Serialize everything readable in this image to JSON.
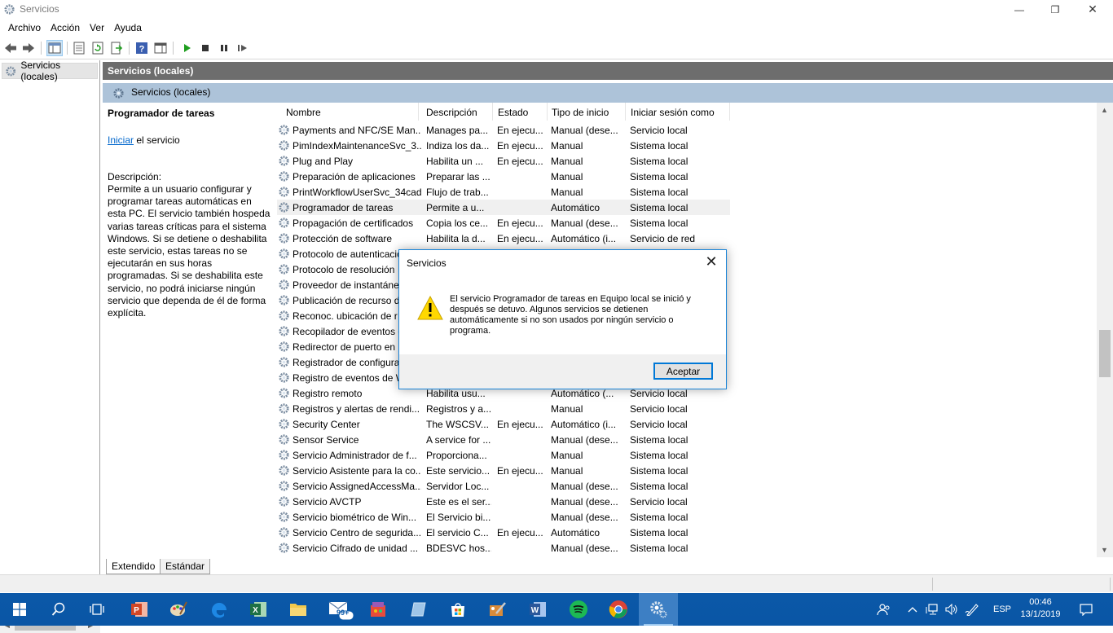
{
  "window": {
    "title": "Servicios",
    "controls": {
      "minimize": "—",
      "maximize": "❐",
      "close": "✕"
    }
  },
  "menu": [
    "Archivo",
    "Acción",
    "Ver",
    "Ayuda"
  ],
  "tree": {
    "root_label": "Servicios (locales)"
  },
  "header": {
    "title": "Servicios (locales)",
    "subtitle": "Servicios (locales)"
  },
  "details": {
    "service_title": "Programador de tareas",
    "action_link": "Iniciar",
    "action_suffix": " el servicio",
    "description_label": "Descripción:",
    "description_text": "Permite a un usuario configurar y programar tareas automáticas en esta PC. El servicio también hospeda varias tareas críticas para el sistema Windows. Si se detiene o deshabilita este servicio, estas tareas no se ejecutarán en sus horas programadas. Si se deshabilita este servicio, no podrá iniciarse ningún servicio que dependa de él de forma explícita."
  },
  "columns": [
    "Nombre",
    "Descripción",
    "Estado",
    "Tipo de inicio",
    "Iniciar sesión como"
  ],
  "rows": [
    {
      "name": "Payments and NFC/SE Man...",
      "desc": "Manages pa...",
      "state": "En ejecu...",
      "start": "Manual (dese...",
      "logon": "Servicio local"
    },
    {
      "name": "PimIndexMaintenanceSvc_3...",
      "desc": "Indiza los da...",
      "state": "En ejecu...",
      "start": "Manual",
      "logon": "Sistema local"
    },
    {
      "name": "Plug and Play",
      "desc": "Habilita un ...",
      "state": "En ejecu...",
      "start": "Manual",
      "logon": "Sistema local"
    },
    {
      "name": "Preparación de aplicaciones",
      "desc": "Preparar las ...",
      "state": "",
      "start": "Manual",
      "logon": "Sistema local"
    },
    {
      "name": "PrintWorkflowUserSvc_34cad",
      "desc": "Flujo de trab...",
      "state": "",
      "start": "Manual",
      "logon": "Sistema local"
    },
    {
      "name": "Programador de tareas",
      "desc": "Permite a u...",
      "state": "",
      "start": "Automático",
      "logon": "Sistema local",
      "selected": true
    },
    {
      "name": "Propagación de certificados",
      "desc": "Copia los ce...",
      "state": "En ejecu...",
      "start": "Manual (dese...",
      "logon": "Sistema local"
    },
    {
      "name": "Protección de software",
      "desc": "Habilita la d...",
      "state": "En ejecu...",
      "start": "Automático (i...",
      "logon": "Servicio de red"
    },
    {
      "name": "Protocolo de autenticación",
      "desc": "",
      "state": "",
      "start": "",
      "logon": ""
    },
    {
      "name": "Protocolo de resolución",
      "desc": "",
      "state": "",
      "start": "",
      "logon": ""
    },
    {
      "name": "Proveedor de instantáne",
      "desc": "",
      "state": "",
      "start": "",
      "logon": ""
    },
    {
      "name": "Publicación de recurso d",
      "desc": "",
      "state": "",
      "start": "",
      "logon": ""
    },
    {
      "name": "Reconoc. ubicación de r",
      "desc": "",
      "state": "",
      "start": "",
      "logon": ""
    },
    {
      "name": "Recopilador de eventos d",
      "desc": "",
      "state": "",
      "start": "",
      "logon": ""
    },
    {
      "name": "Redirector de puerto en",
      "desc": "",
      "state": "",
      "start": "",
      "logon": ""
    },
    {
      "name": "Registrador de configura",
      "desc": "",
      "state": "",
      "start": "",
      "logon": ""
    },
    {
      "name": "Registro de eventos de W",
      "desc": "",
      "state": "",
      "start": "",
      "logon": ""
    },
    {
      "name": "Registro remoto",
      "desc": "Habilita usu...",
      "state": "",
      "start": "Automático (...",
      "logon": "Servicio local"
    },
    {
      "name": "Registros y alertas de rendi...",
      "desc": "Registros y a...",
      "state": "",
      "start": "Manual",
      "logon": "Servicio local"
    },
    {
      "name": "Security Center",
      "desc": "The WSCSV...",
      "state": "En ejecu...",
      "start": "Automático (i...",
      "logon": "Servicio local"
    },
    {
      "name": "Sensor Service",
      "desc": "A service for ...",
      "state": "",
      "start": "Manual (dese...",
      "logon": "Sistema local"
    },
    {
      "name": "Servicio Administrador de f...",
      "desc": "Proporciona...",
      "state": "",
      "start": "Manual",
      "logon": "Sistema local"
    },
    {
      "name": "Servicio Asistente para la co...",
      "desc": "Este servicio...",
      "state": "En ejecu...",
      "start": "Manual",
      "logon": "Sistema local"
    },
    {
      "name": "Servicio AssignedAccessMa...",
      "desc": "Servidor Loc...",
      "state": "",
      "start": "Manual (dese...",
      "logon": "Sistema local"
    },
    {
      "name": "Servicio AVCTP",
      "desc": "Este es el ser...",
      "state": "",
      "start": "Manual (dese...",
      "logon": "Servicio local"
    },
    {
      "name": "Servicio biométrico de Win...",
      "desc": "El Servicio bi...",
      "state": "",
      "start": "Manual (dese...",
      "logon": "Sistema local"
    },
    {
      "name": "Servicio Centro de segurida...",
      "desc": "El servicio C...",
      "state": "En ejecu...",
      "start": "Automático",
      "logon": "Sistema local"
    },
    {
      "name": "Servicio Cifrado de unidad ...",
      "desc": "BDESVC hos...",
      "state": "",
      "start": "Manual (dese...",
      "logon": "Sistema local"
    }
  ],
  "tabs": [
    "Extendido",
    "Estándar"
  ],
  "dialog": {
    "title": "Servicios",
    "message": "El servicio Programador de tareas en Equipo local se inició y después se detuvo. Algunos servicios se detienen automáticamente si no son usados por ningún servicio o programa.",
    "ok_label": "Aceptar"
  },
  "taskbar": {
    "mail_badge": "99+",
    "language": "ESP",
    "time": "00:46",
    "date": "13/1/2019"
  },
  "colors": {
    "accent": "#0078d7",
    "taskbar": "#0a58a8",
    "header_dark": "#6d6d6d",
    "header_light": "#adc3d9"
  }
}
